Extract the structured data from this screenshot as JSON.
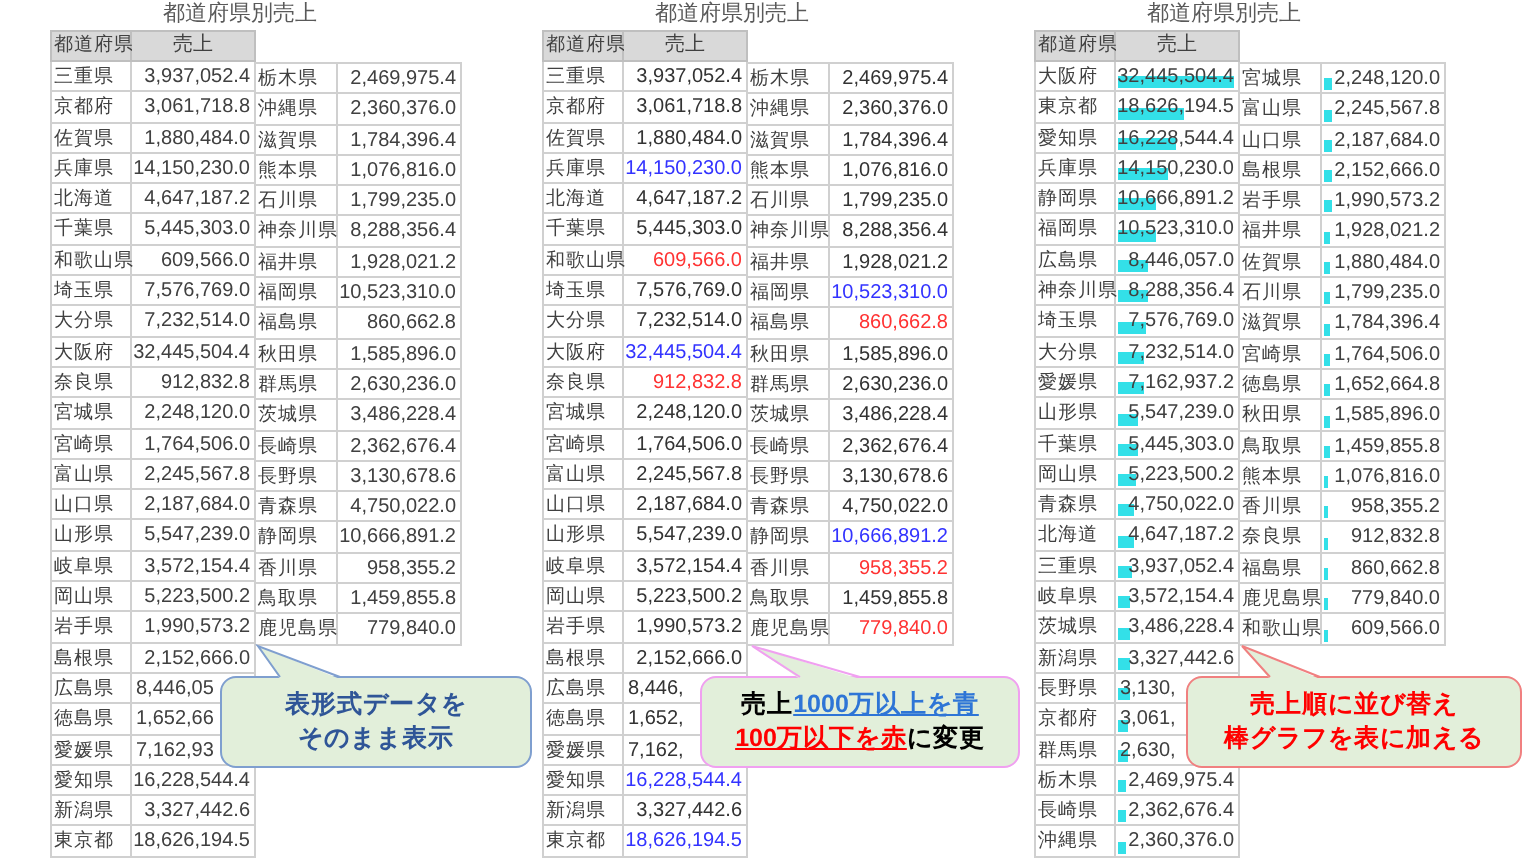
{
  "tables": [
    {
      "title": "都道府県別売上",
      "headers": [
        "都道府県",
        "売上"
      ],
      "left_rows": [
        {
          "name": "三重県",
          "value": "3,937,052.4"
        },
        {
          "name": "京都府",
          "value": "3,061,718.8"
        },
        {
          "name": "佐賀県",
          "value": "1,880,484.0"
        },
        {
          "name": "兵庫県",
          "value": "14,150,230.0"
        },
        {
          "name": "北海道",
          "value": "4,647,187.2"
        },
        {
          "name": "千葉県",
          "value": "5,445,303.0"
        },
        {
          "name": "和歌山県",
          "value": "609,566.0"
        },
        {
          "name": "埼玉県",
          "value": "7,576,769.0"
        },
        {
          "name": "大分県",
          "value": "7,232,514.0"
        },
        {
          "name": "大阪府",
          "value": "32,445,504.4"
        },
        {
          "name": "奈良県",
          "value": "912,832.8"
        },
        {
          "name": "宮城県",
          "value": "2,248,120.0"
        },
        {
          "name": "宮崎県",
          "value": "1,764,506.0"
        },
        {
          "name": "富山県",
          "value": "2,245,567.8"
        },
        {
          "name": "山口県",
          "value": "2,187,684.0"
        },
        {
          "name": "山形県",
          "value": "5,547,239.0"
        },
        {
          "name": "岐阜県",
          "value": "3,572,154.4"
        },
        {
          "name": "岡山県",
          "value": "5,223,500.2"
        },
        {
          "name": "岩手県",
          "value": "1,990,573.2"
        },
        {
          "name": "島根県",
          "value": "2,152,666.0"
        },
        {
          "name": "広島県",
          "value": "8,446,05",
          "kind": "cut"
        },
        {
          "name": "徳島県",
          "value": "1,652,66",
          "kind": "cut"
        },
        {
          "name": "愛媛県",
          "value": "7,162,93",
          "kind": "cut"
        },
        {
          "name": "愛知県",
          "value": "16,228,544.4"
        },
        {
          "name": "新潟県",
          "value": "3,327,442.6"
        },
        {
          "name": "東京都",
          "value": "18,626,194.5"
        }
      ],
      "right_rows": [
        {
          "name": "栃木県",
          "value": "2,469,975.4"
        },
        {
          "name": "沖縄県",
          "value": "2,360,376.0"
        },
        {
          "name": "滋賀県",
          "value": "1,784,396.4"
        },
        {
          "name": "熊本県",
          "value": "1,076,816.0"
        },
        {
          "name": "石川県",
          "value": "1,799,235.0"
        },
        {
          "name": "神奈川県",
          "value": "8,288,356.4"
        },
        {
          "name": "福井県",
          "value": "1,928,021.2"
        },
        {
          "name": "福岡県",
          "value": "10,523,310.0"
        },
        {
          "name": "福島県",
          "value": "860,662.8"
        },
        {
          "name": "秋田県",
          "value": "1,585,896.0"
        },
        {
          "name": "群馬県",
          "value": "2,630,236.0"
        },
        {
          "name": "茨城県",
          "value": "3,486,228.4"
        },
        {
          "name": "長崎県",
          "value": "2,362,676.4"
        },
        {
          "name": "長野県",
          "value": "3,130,678.6"
        },
        {
          "name": "青森県",
          "value": "4,750,022.0"
        },
        {
          "name": "静岡県",
          "value": "10,666,891.2"
        },
        {
          "name": "香川県",
          "value": "958,355.2"
        },
        {
          "name": "鳥取県",
          "value": "1,459,855.8"
        },
        {
          "name": "鹿児島県",
          "value": "779,840.0"
        }
      ]
    },
    {
      "title": "都道府県別売上",
      "headers": [
        "都道府県",
        "売上"
      ],
      "left_rows": [
        {
          "name": "三重県",
          "value": "3,937,052.4",
          "color": "#333333"
        },
        {
          "name": "京都府",
          "value": "3,061,718.8",
          "color": "#333333"
        },
        {
          "name": "佐賀県",
          "value": "1,880,484.0",
          "color": "#333333"
        },
        {
          "name": "兵庫県",
          "value": "14,150,230.0",
          "color": "#3333ff"
        },
        {
          "name": "北海道",
          "value": "4,647,187.2",
          "color": "#333333"
        },
        {
          "name": "千葉県",
          "value": "5,445,303.0",
          "color": "#333333"
        },
        {
          "name": "和歌山県",
          "value": "609,566.0",
          "color": "#ff3333"
        },
        {
          "name": "埼玉県",
          "value": "7,576,769.0",
          "color": "#333333"
        },
        {
          "name": "大分県",
          "value": "7,232,514.0",
          "color": "#333333"
        },
        {
          "name": "大阪府",
          "value": "32,445,504.4",
          "color": "#3333ff"
        },
        {
          "name": "奈良県",
          "value": "912,832.8",
          "color": "#ff3333"
        },
        {
          "name": "宮城県",
          "value": "2,248,120.0",
          "color": "#333333"
        },
        {
          "name": "宮崎県",
          "value": "1,764,506.0",
          "color": "#333333"
        },
        {
          "name": "富山県",
          "value": "2,245,567.8",
          "color": "#333333"
        },
        {
          "name": "山口県",
          "value": "2,187,684.0",
          "color": "#333333"
        },
        {
          "name": "山形県",
          "value": "5,547,239.0",
          "color": "#333333"
        },
        {
          "name": "岐阜県",
          "value": "3,572,154.4",
          "color": "#333333"
        },
        {
          "name": "岡山県",
          "value": "5,223,500.2",
          "color": "#333333"
        },
        {
          "name": "岩手県",
          "value": "1,990,573.2",
          "color": "#333333"
        },
        {
          "name": "島根県",
          "value": "2,152,666.0",
          "color": "#333333"
        },
        {
          "name": "広島県",
          "value": "8,446,",
          "kind": "cut",
          "color": "#333333"
        },
        {
          "name": "徳島県",
          "value": "1,652,",
          "kind": "cut",
          "color": "#333333"
        },
        {
          "name": "愛媛県",
          "value": "7,162,",
          "kind": "cut",
          "color": "#333333"
        },
        {
          "name": "愛知県",
          "value": "16,228,544.4",
          "color": "#3333ff"
        },
        {
          "name": "新潟県",
          "value": "3,327,442.6",
          "color": "#333333"
        },
        {
          "name": "東京都",
          "value": "18,626,194.5",
          "color": "#3333ff"
        }
      ],
      "right_rows": [
        {
          "name": "栃木県",
          "value": "2,469,975.4",
          "color": "#333333"
        },
        {
          "name": "沖縄県",
          "value": "2,360,376.0",
          "color": "#333333"
        },
        {
          "name": "滋賀県",
          "value": "1,784,396.4",
          "color": "#333333"
        },
        {
          "name": "熊本県",
          "value": "1,076,816.0",
          "color": "#333333"
        },
        {
          "name": "石川県",
          "value": "1,799,235.0",
          "color": "#333333"
        },
        {
          "name": "神奈川県",
          "value": "8,288,356.4",
          "color": "#333333"
        },
        {
          "name": "福井県",
          "value": "1,928,021.2",
          "color": "#333333"
        },
        {
          "name": "福岡県",
          "value": "10,523,310.0",
          "color": "#3333ff"
        },
        {
          "name": "福島県",
          "value": "860,662.8",
          "color": "#ff3333"
        },
        {
          "name": "秋田県",
          "value": "1,585,896.0",
          "color": "#333333"
        },
        {
          "name": "群馬県",
          "value": "2,630,236.0",
          "color": "#333333"
        },
        {
          "name": "茨城県",
          "value": "3,486,228.4",
          "color": "#333333"
        },
        {
          "name": "長崎県",
          "value": "2,362,676.4",
          "color": "#333333"
        },
        {
          "name": "長野県",
          "value": "3,130,678.6",
          "color": "#333333"
        },
        {
          "name": "青森県",
          "value": "4,750,022.0",
          "color": "#333333"
        },
        {
          "name": "静岡県",
          "value": "10,666,891.2",
          "color": "#3333ff"
        },
        {
          "name": "香川県",
          "value": "958,355.2",
          "color": "#ff3333"
        },
        {
          "name": "鳥取県",
          "value": "1,459,855.8",
          "color": "#333333"
        },
        {
          "name": "鹿児島県",
          "value": "779,840.0",
          "color": "#ff3333"
        }
      ]
    },
    {
      "title": "都道府県別売上",
      "headers": [
        "都道府県",
        "売上"
      ],
      "left_rows": [
        {
          "name": "大阪府",
          "value": "32,445,504.4",
          "level": 1.0
        },
        {
          "name": "東京都",
          "value": "18,626,194.5",
          "level": 0.574
        },
        {
          "name": "愛知県",
          "value": "16,228,544.4",
          "level": 0.5
        },
        {
          "name": "兵庫県",
          "value": "14,150,230.0",
          "level": 0.436
        },
        {
          "name": "静岡県",
          "value": "10,666,891.2",
          "level": 0.329
        },
        {
          "name": "福岡県",
          "value": "10,523,310.0",
          "level": 0.324
        },
        {
          "name": "広島県",
          "value": "8,446,057.0",
          "level": 0.26
        },
        {
          "name": "神奈川県",
          "value": "8,288,356.4",
          "level": 0.255
        },
        {
          "name": "埼玉県",
          "value": "7,576,769.0",
          "level": 0.234
        },
        {
          "name": "大分県",
          "value": "7,232,514.0",
          "level": 0.223
        },
        {
          "name": "愛媛県",
          "value": "7,162,937.2",
          "level": 0.221
        },
        {
          "name": "山形県",
          "value": "5,547,239.0",
          "level": 0.171
        },
        {
          "name": "千葉県",
          "value": "5,445,303.0",
          "level": 0.168
        },
        {
          "name": "岡山県",
          "value": "5,223,500.2",
          "level": 0.161
        },
        {
          "name": "青森県",
          "value": "4,750,022.0",
          "level": 0.146
        },
        {
          "name": "北海道",
          "value": "4,647,187.2",
          "level": 0.143
        },
        {
          "name": "三重県",
          "value": "3,937,052.4",
          "level": 0.121
        },
        {
          "name": "岐阜県",
          "value": "3,572,154.4",
          "level": 0.11
        },
        {
          "name": "茨城県",
          "value": "3,486,228.4",
          "level": 0.107
        },
        {
          "name": "新潟県",
          "value": "3,327,442.6",
          "level": 0.103
        },
        {
          "name": "長野県",
          "value": "3,130,",
          "kind": "cut",
          "level": 0.096
        },
        {
          "name": "京都府",
          "value": "3,061,",
          "kind": "cut",
          "level": 0.094
        },
        {
          "name": "群馬県",
          "value": "2,630,",
          "kind": "cut",
          "level": 0.081
        },
        {
          "name": "栃木県",
          "value": "2,469,975.4",
          "level": 0.076
        },
        {
          "name": "長崎県",
          "value": "2,362,676.4",
          "level": 0.073
        },
        {
          "name": "沖縄県",
          "value": "2,360,376.0",
          "level": 0.073
        }
      ],
      "right_rows": [
        {
          "name": "宮城県",
          "value": "2,248,120.0",
          "level": 0.069
        },
        {
          "name": "富山県",
          "value": "2,245,567.8",
          "level": 0.069
        },
        {
          "name": "山口県",
          "value": "2,187,684.0",
          "level": 0.067
        },
        {
          "name": "島根県",
          "value": "2,152,666.0",
          "level": 0.066
        },
        {
          "name": "岩手県",
          "value": "1,990,573.2",
          "level": 0.061
        },
        {
          "name": "福井県",
          "value": "1,928,021.2",
          "level": 0.059
        },
        {
          "name": "佐賀県",
          "value": "1,880,484.0",
          "level": 0.058
        },
        {
          "name": "石川県",
          "value": "1,799,235.0",
          "level": 0.055
        },
        {
          "name": "滋賀県",
          "value": "1,784,396.4",
          "level": 0.055
        },
        {
          "name": "宮崎県",
          "value": "1,764,506.0",
          "level": 0.054
        },
        {
          "name": "徳島県",
          "value": "1,652,664.8",
          "level": 0.051
        },
        {
          "name": "秋田県",
          "value": "1,585,896.0",
          "level": 0.049
        },
        {
          "name": "鳥取県",
          "value": "1,459,855.8",
          "level": 0.045
        },
        {
          "name": "熊本県",
          "value": "1,076,816.0",
          "level": 0.033
        },
        {
          "name": "香川県",
          "value": "958,355.2",
          "level": 0.03
        },
        {
          "name": "奈良県",
          "value": "912,832.8",
          "level": 0.028
        },
        {
          "name": "福島県",
          "value": "860,662.8",
          "level": 0.027
        },
        {
          "name": "鹿児島県",
          "value": "779,840.0",
          "level": 0.024
        },
        {
          "name": "和歌山県",
          "value": "609,566.0",
          "level": 0.019
        }
      ]
    }
  ],
  "callouts": [
    {
      "kind": "note",
      "lines": [
        [
          {
            "text": "表形式データを",
            "color": "#2f5597",
            "underline": false
          }
        ],
        [
          {
            "text": "そのまま表示",
            "color": "#2f5597",
            "underline": false
          }
        ]
      ]
    },
    {
      "kind": "rule",
      "lines": [
        [
          {
            "text": "売上",
            "color": "#000000",
            "underline": false
          },
          {
            "text": "1000万以上を青",
            "color": "#2e75d6",
            "underline": true
          }
        ],
        [
          {
            "text": "100万以下を赤",
            "color": "#ff0000",
            "underline": true
          },
          {
            "text": "に変更",
            "color": "#000000",
            "underline": false
          }
        ]
      ]
    },
    {
      "kind": "sort",
      "lines": [
        [
          {
            "text": "売上順に並び替え",
            "color": "#ff0000",
            "underline": false
          }
        ],
        [
          {
            "text": "棒グラフを表に加える",
            "color": "#ff0000",
            "underline": false
          }
        ]
      ]
    }
  ]
}
